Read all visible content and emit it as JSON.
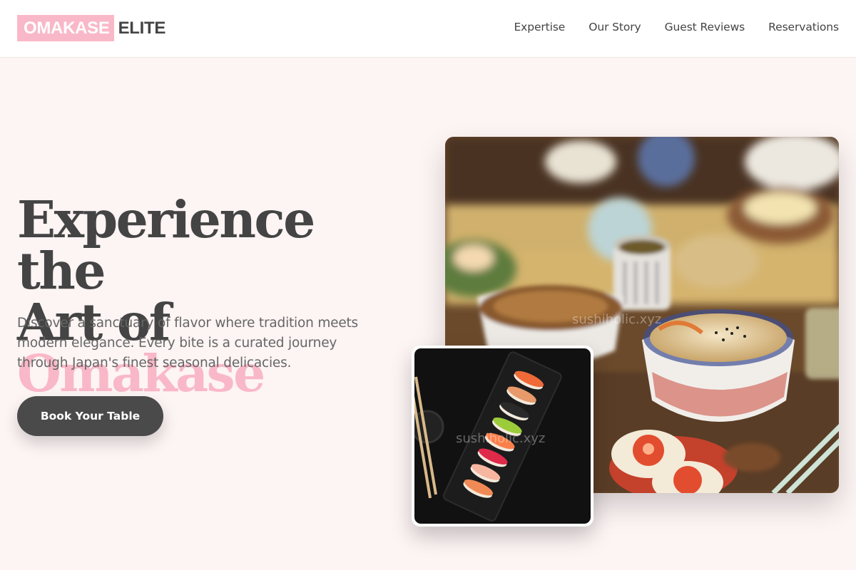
{
  "brand": {
    "highlight": "OMAKASE",
    "rest": "ELITE",
    "accent_color": "#f9b8c8"
  },
  "nav": {
    "items": [
      {
        "label": "Expertise"
      },
      {
        "label": "Our Story"
      },
      {
        "label": "Guest Reviews"
      },
      {
        "label": "Reservations"
      }
    ]
  },
  "hero": {
    "title_line1": "Experience the",
    "title_line2_prefix": "Art of ",
    "title_accent": "Omakase",
    "subtitle": "Discover a sanctuary of flavor where tradition meets modern elegance. Every bite is a curated journey through Japan's finest seasonal delicacies.",
    "cta_label": "Book Your Table"
  },
  "images": {
    "main_watermark": "sushiholic.xyz",
    "secondary_watermark": "sushiholic.xyz"
  }
}
